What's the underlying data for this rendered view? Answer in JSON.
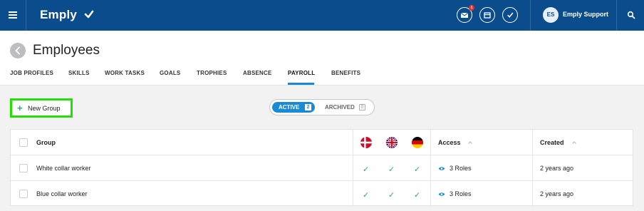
{
  "topbar": {
    "logo_text": "Emply",
    "user_initials": "ES",
    "user_name": "Emply Support",
    "mail_badge": "1",
    "icons": [
      "menu-icon",
      "mail-icon",
      "calendar-icon",
      "check-icon",
      "search-icon"
    ]
  },
  "header": {
    "title": "Employees",
    "tabs": [
      {
        "label": "JOB PROFILES"
      },
      {
        "label": "SKILLS"
      },
      {
        "label": "WORK TASKS"
      },
      {
        "label": "GOALS"
      },
      {
        "label": "TROPHIES"
      },
      {
        "label": "ABSENCE"
      },
      {
        "label": "PAYROLL",
        "active": true
      },
      {
        "label": "BENEFITS"
      }
    ]
  },
  "toolbar": {
    "new_group_label": "New Group",
    "active_label": "ACTIVE",
    "active_count": "2",
    "archived_label": "ARCHIVED",
    "archived_count": "0"
  },
  "table": {
    "columns": {
      "group": "Group",
      "flags": [
        "danish-flag-icon",
        "uk-flag-icon",
        "german-flag-icon"
      ],
      "access": "Access",
      "created": "Created"
    },
    "rows": [
      {
        "group": "White collar worker",
        "access": "3 Roles",
        "created": "2 years ago",
        "checks": [
          true,
          true,
          true
        ]
      },
      {
        "group": "Blue collar worker",
        "access": "3 Roles",
        "created": "2 years ago",
        "checks": [
          true,
          true,
          true
        ]
      }
    ]
  },
  "colors": {
    "topbar_bg": "#0b4d8c",
    "accent": "#1a8ad4",
    "highlight_border": "#22e000",
    "check_green": "#27ae60"
  }
}
